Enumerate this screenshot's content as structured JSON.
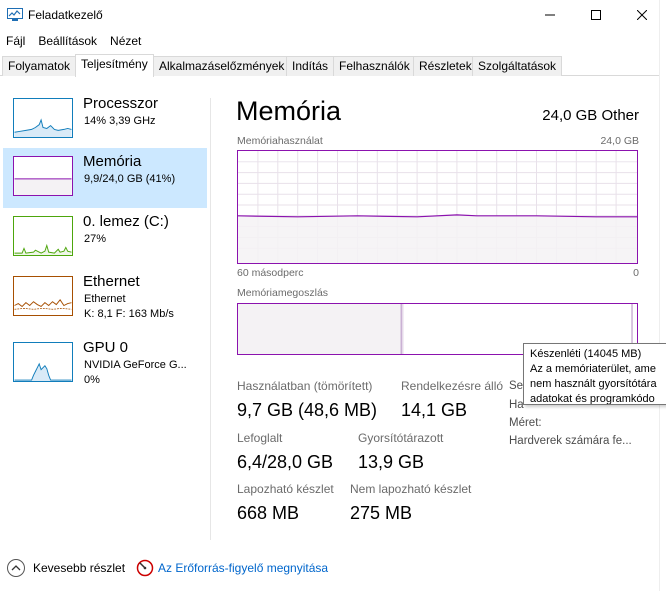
{
  "window": {
    "title": "Feladatkezelő"
  },
  "menu": [
    "Fájl",
    "Beállítások",
    "Nézet"
  ],
  "tabs": [
    "Folyamatok",
    "Teljesítmény",
    "Alkalmazáselőzmények",
    "Indítás",
    "Felhasználók",
    "Részletek",
    "Szolgáltatások"
  ],
  "active_tab": "Teljesítmény",
  "sidebar": {
    "items": [
      {
        "title": "Processzor",
        "sub1": "14% 3,39 GHz",
        "sub2": "",
        "sub3": "",
        "color": "#117dbb"
      },
      {
        "title": "Memória",
        "sub1": "9,9/24,0 GB (41%)",
        "sub2": "",
        "sub3": "",
        "color": "#8b12ae"
      },
      {
        "title": "0. lemez (C:)",
        "sub1": "27%",
        "sub2": "",
        "sub3": "",
        "color": "#4da60c"
      },
      {
        "title": "Ethernet",
        "sub1": "Ethernet",
        "sub2": "K: 8,1  F: 163 Mb/s",
        "sub3": "",
        "color": "#a74f01"
      },
      {
        "title": "GPU 0",
        "sub1": "NVIDIA GeForce G...",
        "sub2": "0%",
        "sub3": "",
        "color": "#117dbb"
      }
    ]
  },
  "main": {
    "title": "Memória",
    "capacity": "24,0 GB Other",
    "usage_label": "Memóriahasználat",
    "usage_max": "24,0 GB",
    "time_left": "60 másodperc",
    "time_right": "0",
    "composition_label": "Memóriamegoszlás",
    "usage_fraction": 0.41
  },
  "stats": {
    "in_use_label": "Használatban (tömörített)",
    "in_use_value": "9,7 GB (48,6 MB)",
    "available_label": "Rendelkezésre álló",
    "available_value": "14,1 GB",
    "committed_label": "Lefoglalt",
    "committed_value": "6,4/28,0 GB",
    "cached_label": "Gyorsítótárazott",
    "cached_value": "13,9 GB",
    "paged_label": "Lapozható készlet",
    "paged_value": "668 MB",
    "nonpaged_label": "Nem lapozható készlet",
    "nonpaged_value": "275 MB",
    "slots_label": "Se",
    "form_label": "Ha",
    "size_label": "Méret:",
    "hw_label": "Hardverek számára fe..."
  },
  "tooltip": {
    "line1": "Készenléti (14045 MB)",
    "line2": "Az a memóriaterület, ame",
    "line3": "nem használt gyorsítótára",
    "line4": "adatokat és programkódo"
  },
  "footer": {
    "fewer_details": "Kevesebb részlet",
    "open_monitor": "Az Erőforrás-figyelő megnyitása"
  },
  "colors": {
    "memory": "#8b12ae",
    "selected_bg": "#cce8ff",
    "link": "#0066cc"
  }
}
